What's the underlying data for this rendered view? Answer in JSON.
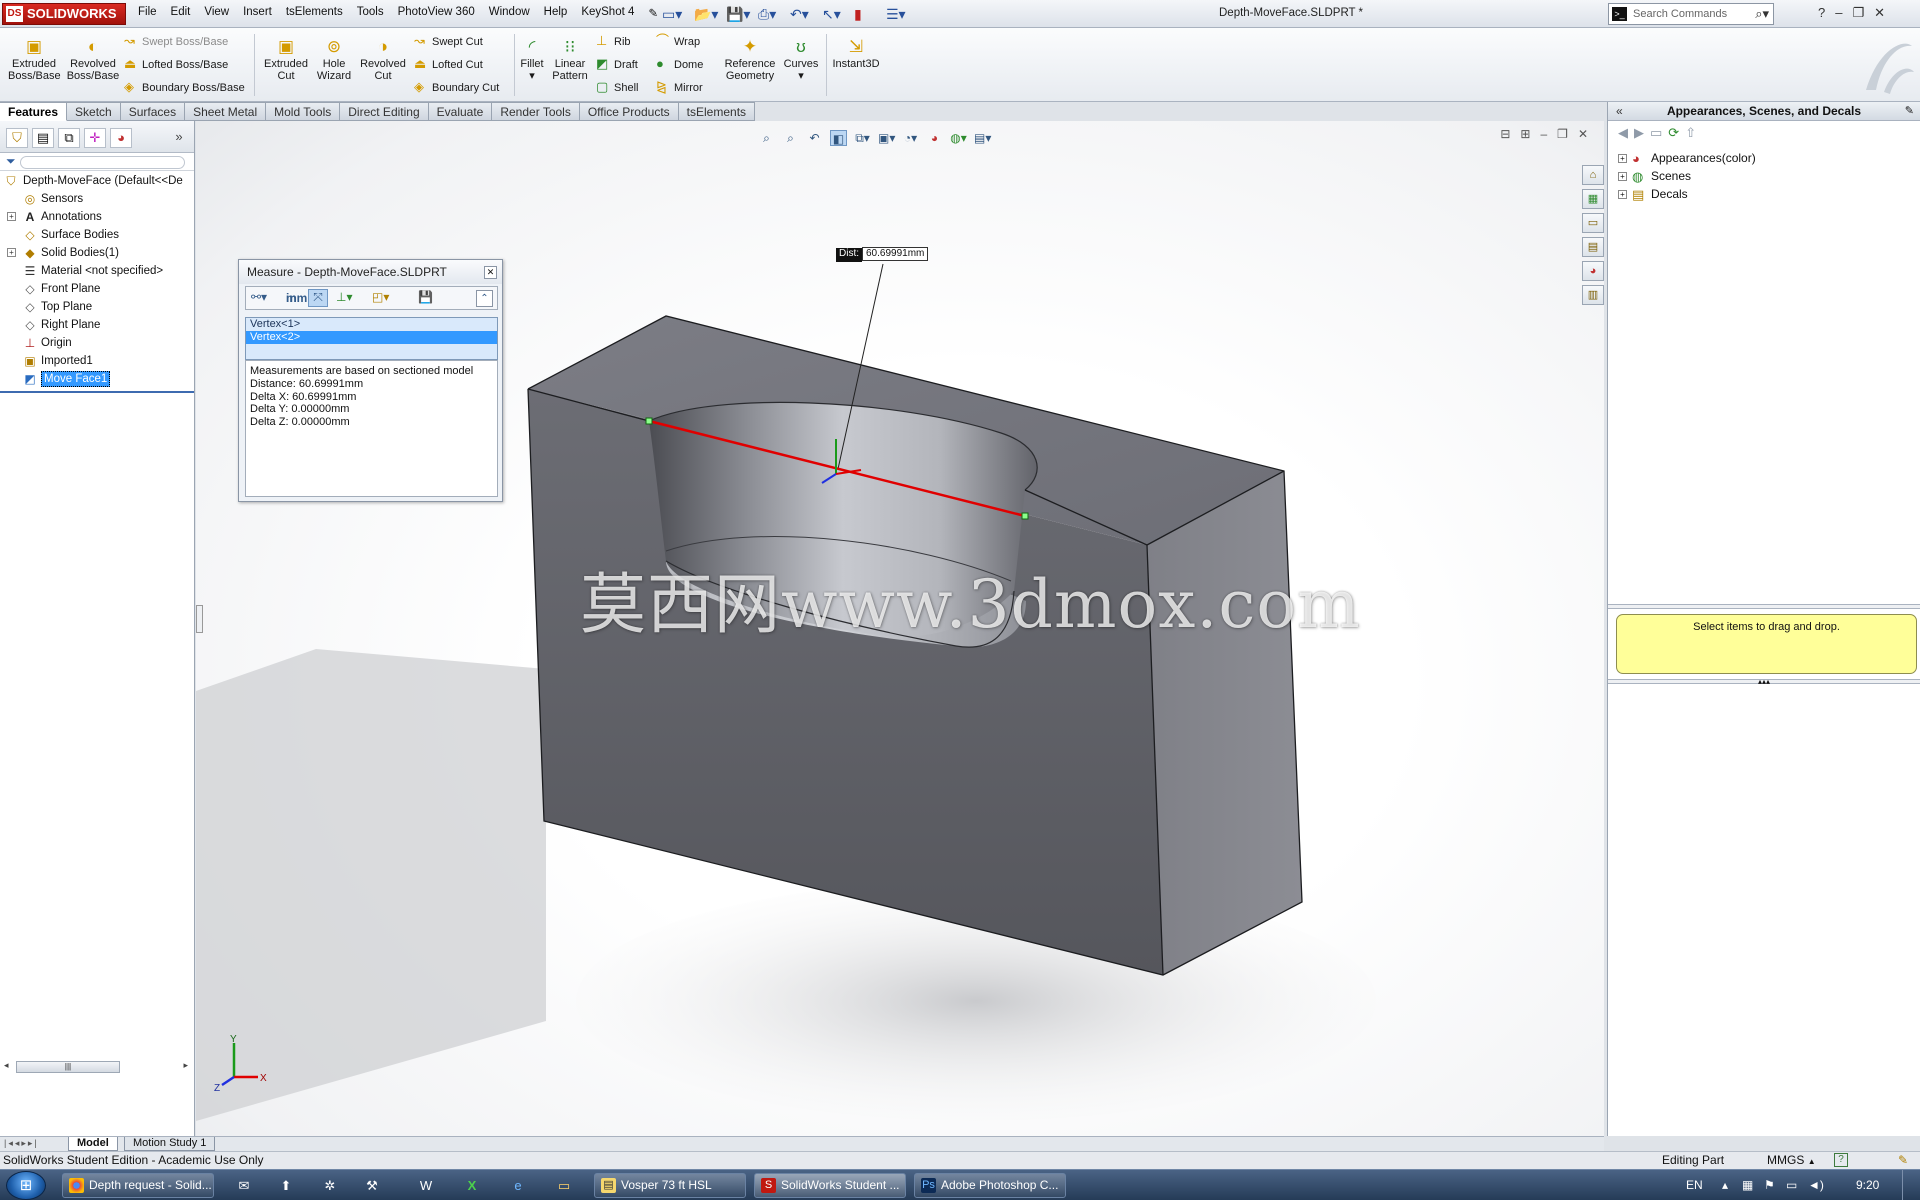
{
  "app": {
    "brand": "SOLIDWORKS",
    "brand_mark": "DS",
    "document_title": "Depth-MoveFace.SLDPRT *",
    "search_placeholder": "Search Commands",
    "search_icon": "magnifier-icon",
    "window_controls": [
      "?",
      "–",
      "❐",
      "✕"
    ]
  },
  "menu": [
    "File",
    "Edit",
    "View",
    "Insert",
    "tsElements",
    "Tools",
    "PhotoView 360",
    "Window",
    "Help",
    "KeyShot 4"
  ],
  "quick_access": [
    "new-document-icon",
    "open-icon",
    "save-icon",
    "print-icon",
    "undo-icon",
    "select-icon",
    "rebuild-icon",
    "options-icon"
  ],
  "command_manager": {
    "big_buttons": [
      {
        "label1": "Extruded",
        "label2": "Boss/Base"
      },
      {
        "label1": "Revolved",
        "label2": "Boss/Base"
      },
      {
        "label1": "Extruded",
        "label2": "Cut"
      },
      {
        "label1": "Hole",
        "label2": "Wizard"
      },
      {
        "label1": "Revolved",
        "label2": "Cut"
      },
      {
        "label1": "Fillet",
        "label2": ""
      },
      {
        "label1": "Linear",
        "label2": "Pattern"
      },
      {
        "label1": "Reference",
        "label2": "Geometry"
      },
      {
        "label1": "Curves",
        "label2": ""
      },
      {
        "label1": "Instant3D",
        "label2": ""
      }
    ],
    "small_buttons": [
      "Swept Boss/Base",
      "Lofted Boss/Base",
      "Boundary Boss/Base",
      "Swept Cut",
      "Lofted Cut",
      "Boundary Cut",
      "Rib",
      "Draft",
      "Shell",
      "Wrap",
      "Dome",
      "Mirror"
    ]
  },
  "tabs": [
    "Features",
    "Sketch",
    "Surfaces",
    "Sheet Metal",
    "Mold Tools",
    "Direct Editing",
    "Evaluate",
    "Render Tools",
    "Office Products",
    "tsElements"
  ],
  "feature_tree": {
    "root": "Depth-MoveFace  (Default<<De",
    "items": [
      "Sensors",
      "Annotations",
      "Surface Bodies",
      "Solid Bodies(1)",
      "Material <not specified>",
      "Front Plane",
      "Top Plane",
      "Right Plane",
      "Origin",
      "Imported1",
      "Move Face1"
    ],
    "selected": "Move Face1"
  },
  "measure": {
    "title": "Measure - Depth-MoveFace.SLDPRT",
    "units_icon_top": "in",
    "units_icon_bottom": "mm",
    "selections": [
      "Vertex<1>",
      "Vertex<2>"
    ],
    "results": [
      "Measurements are based on sectioned model",
      "Distance: 60.69991mm",
      "Delta X: 60.69991mm",
      "Delta Y: 0.00000mm",
      "Delta Z: 0.00000mm"
    ]
  },
  "callout": {
    "key": "Dist:",
    "value": "60.69991mm"
  },
  "watermark": "莫西网www.3dmox.com",
  "triad": {
    "x": "X",
    "y": "Y",
    "z": "Z"
  },
  "task_pane": {
    "title": "Appearances, Scenes, and Decals",
    "collapse": "«",
    "items": [
      "Appearances(color)",
      "Scenes",
      "Decals"
    ],
    "drop_hint": "Select items to drag and drop."
  },
  "bottom_tabs": [
    "Model",
    "Motion Study 1"
  ],
  "status": {
    "left": "SolidWorks Student Edition - Academic Use Only",
    "mode": "Editing Part",
    "units": "MMGS",
    "units_arrow": "▲",
    "help": "?"
  },
  "taskbar": {
    "tasks": [
      "Depth request - Solid...",
      "Vosper 73 ft HSL",
      "SolidWorks Student ...",
      "Adobe Photoshop C..."
    ],
    "language": "EN",
    "clock": "9:20"
  },
  "colors": {
    "measure_line": "#e00000",
    "model_face": "#5f6066",
    "selection_blue": "#3399ff",
    "drop_hint_bg": "#ffff99"
  }
}
